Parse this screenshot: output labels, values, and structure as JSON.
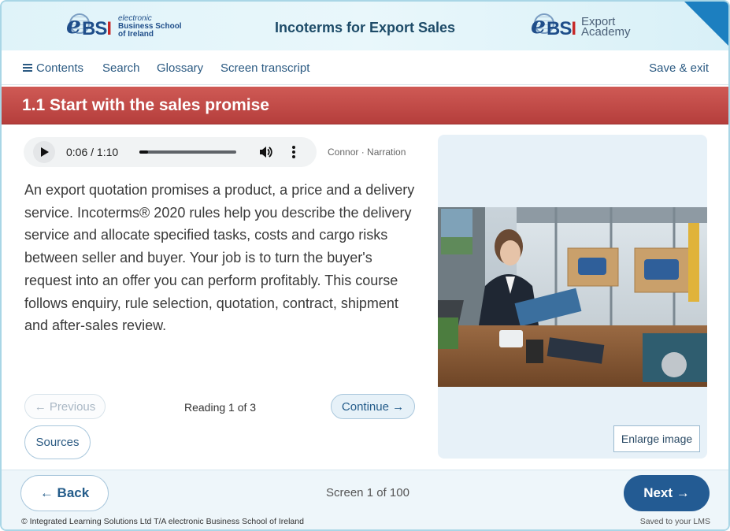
{
  "header": {
    "left_logo": {
      "brand": "BSI",
      "line1": "electronic",
      "line2": "Business School",
      "line3": "of Ireland"
    },
    "course_title": "Incoterms for Export Sales",
    "right_logo": {
      "brand": "BSI",
      "line1": "Export",
      "line2": "Academy"
    },
    "accent_color": "#1c7fc0"
  },
  "nav": {
    "contents": "Contents",
    "search": "Search",
    "glossary": "Glossary",
    "transcript": "Screen transcript",
    "save_exit": "Save & exit"
  },
  "section": {
    "title": "1.1 Start with the sales promise",
    "band_color": "#c04a47"
  },
  "audio": {
    "time": "0:06 / 1:10",
    "progress": 0.086,
    "narration": "Connor · Narration"
  },
  "body": {
    "text": "An export quotation promises a product, a price and a delivery service. Incoterms® 2020 rules help you describe the delivery service and allocate specified tasks, costs and cargo risks between seller and buyer. Your job is to turn the buyer's request into an offer you can perform profitably. This course follows enquiry, rule selection, quotation, contract, shipment and after-sales review."
  },
  "reading": {
    "previous_label": "← Previous",
    "status": "Reading 1 of 3",
    "continue_label": "Continue →",
    "sources_label": "Sources"
  },
  "image_panel": {
    "enlarge_label": "Enlarge image"
  },
  "footer": {
    "back_label": "← Back",
    "screen_counter": "Screen 1 of 100",
    "next_label": "Next →",
    "copyright": "© Integrated Learning Solutions Ltd T/A electronic Business School of Ireland",
    "saved": "Saved to your LMS"
  }
}
